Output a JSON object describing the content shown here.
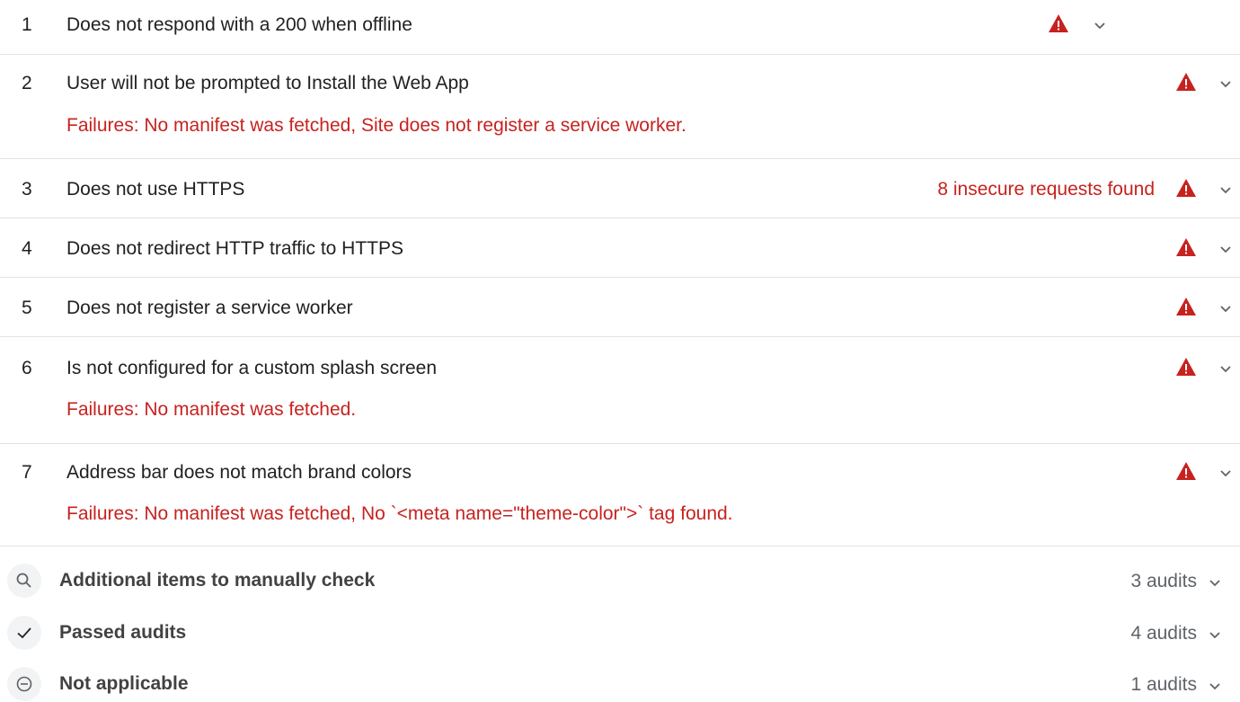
{
  "audits": [
    {
      "num": "1",
      "title": "Does not respond with a 200 when offline",
      "failure": "",
      "display": "",
      "icon": "warning-triangle-icon"
    },
    {
      "num": "2",
      "title": "User will not be prompted to Install the Web App",
      "failure": "Failures: No manifest was fetched, Site does not register a service worker.",
      "display": "",
      "icon": "warning-triangle-icon"
    },
    {
      "num": "3",
      "title": "Does not use HTTPS",
      "failure": "",
      "display": "8 insecure requests found",
      "icon": "warning-triangle-icon"
    },
    {
      "num": "4",
      "title": "Does not redirect HTTP traffic to HTTPS",
      "failure": "",
      "display": "",
      "icon": "warning-triangle-icon"
    },
    {
      "num": "5",
      "title": "Does not register a service worker",
      "failure": "",
      "display": "",
      "icon": "warning-triangle-icon"
    },
    {
      "num": "6",
      "title": "Is not configured for a custom splash screen",
      "failure": "Failures: No manifest was fetched.",
      "display": "",
      "icon": "warning-triangle-icon"
    },
    {
      "num": "7",
      "title": "Address bar does not match brand colors",
      "failure": "Failures: No manifest was fetched, No `<meta name=\"theme-color\">` tag found.",
      "display": "",
      "icon": "warning-triangle-icon"
    }
  ],
  "groups": [
    {
      "title": "Additional items to manually check",
      "count": "3 audits",
      "icon": "search-icon"
    },
    {
      "title": "Passed audits",
      "count": "4 audits",
      "icon": "checkmark-icon"
    },
    {
      "title": "Not applicable",
      "count": "1 audits",
      "icon": "minus-circle-icon"
    }
  ],
  "colors": {
    "fail": "#c7221f",
    "warning_icon": "#c7221f",
    "text": "#212121",
    "muted": "#5f6368",
    "divider": "#e3e3e3"
  }
}
